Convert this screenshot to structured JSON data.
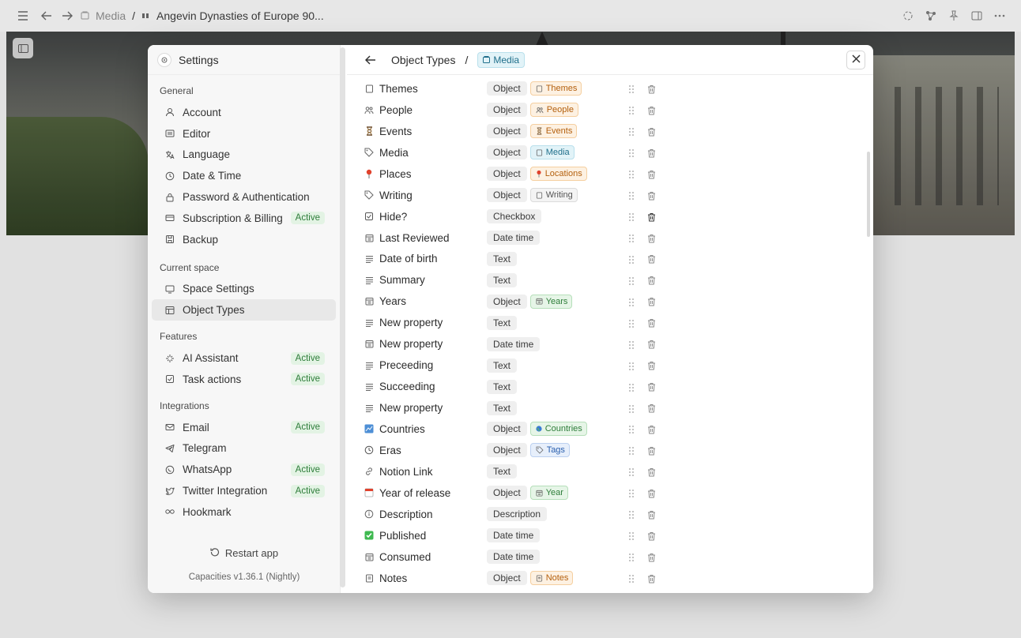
{
  "topbar": {
    "breadcrumb": [
      {
        "label": "Media",
        "icon": "media-icon"
      },
      {
        "label": "Angevin Dynasties of Europe 90..."
      }
    ],
    "separator": "/"
  },
  "sidebar": {
    "title": "Settings",
    "sections": [
      {
        "label": "General",
        "items": [
          {
            "label": "Account",
            "icon": "account-icon"
          },
          {
            "label": "Editor",
            "icon": "editor-icon"
          },
          {
            "label": "Language",
            "icon": "language-icon"
          },
          {
            "label": "Date & Time",
            "icon": "clock-icon"
          },
          {
            "label": "Password & Authentication",
            "icon": "lock-icon"
          },
          {
            "label": "Subscription & Billing",
            "icon": "card-icon",
            "badge": "Active"
          },
          {
            "label": "Backup",
            "icon": "backup-icon"
          }
        ]
      },
      {
        "label": "Current space",
        "items": [
          {
            "label": "Space Settings",
            "icon": "monitor-icon"
          },
          {
            "label": "Object Types",
            "icon": "table-icon",
            "selected": true
          }
        ]
      },
      {
        "label": "Features",
        "items": [
          {
            "label": "AI Assistant",
            "icon": "sparkle-icon",
            "badge": "Active"
          },
          {
            "label": "Task actions",
            "icon": "checkbox-icon",
            "badge": "Active"
          }
        ]
      },
      {
        "label": "Integrations",
        "items": [
          {
            "label": "Email",
            "icon": "mail-icon",
            "badge": "Active"
          },
          {
            "label": "Telegram",
            "icon": "telegram-icon"
          },
          {
            "label": "WhatsApp",
            "icon": "whatsapp-icon",
            "badge": "Active"
          },
          {
            "label": "Twitter Integration",
            "icon": "twitter-icon",
            "badge": "Active"
          },
          {
            "label": "Hookmark",
            "icon": "infinity-icon"
          }
        ]
      }
    ],
    "restart_label": "Restart app",
    "version": "Capacities v1.36.1 (Nightly)"
  },
  "main": {
    "title": "Object Types",
    "separator": "/",
    "chip": "Media",
    "properties": [
      {
        "name": "Themes",
        "type": "Object",
        "target": "Themes",
        "color": "orange",
        "icon": "page-icon"
      },
      {
        "name": "People",
        "type": "Object",
        "target": "People",
        "color": "orange",
        "icon": "people-icon"
      },
      {
        "name": "Events",
        "type": "Object",
        "target": "Events",
        "color": "orange",
        "icon": "hourglass-icon"
      },
      {
        "name": "Media",
        "type": "Object",
        "target": "Media",
        "color": "teal",
        "icon": "tag-icon"
      },
      {
        "name": "Places",
        "type": "Object",
        "target": "Locations",
        "color": "orange",
        "icon": "pin-icon"
      },
      {
        "name": "Writing",
        "type": "Object",
        "target": "Writing",
        "color": "gray",
        "icon": "tag-icon"
      },
      {
        "name": "Hide?",
        "type": "Checkbox",
        "icon": "checkbox-icon"
      },
      {
        "name": "Last Reviewed",
        "type": "Date time",
        "icon": "calendar-icon"
      },
      {
        "name": "Date of birth",
        "type": "Text",
        "icon": "text-icon"
      },
      {
        "name": "Summary",
        "type": "Text",
        "icon": "text-icon"
      },
      {
        "name": "Years",
        "type": "Object",
        "target": "Years",
        "color": "green",
        "icon": "calendar-icon"
      },
      {
        "name": "New property",
        "type": "Text",
        "icon": "text-icon"
      },
      {
        "name": "New property",
        "type": "Date time",
        "icon": "calendar-icon"
      },
      {
        "name": "Preceeding",
        "type": "Text",
        "icon": "text-icon"
      },
      {
        "name": "Succeeding",
        "type": "Text",
        "icon": "text-icon"
      },
      {
        "name": "New property",
        "type": "Text",
        "icon": "text-icon"
      },
      {
        "name": "Countries",
        "type": "Object",
        "target": "Countries",
        "color": "green",
        "icon": "map-icon"
      },
      {
        "name": "Eras",
        "type": "Object",
        "target": "Tags",
        "color": "blue",
        "icon": "clock-icon"
      },
      {
        "name": "Notion Link",
        "type": "Text",
        "icon": "link-icon"
      },
      {
        "name": "Year of release",
        "type": "Object",
        "target": "Year",
        "color": "green",
        "icon": "calendar-page-icon"
      },
      {
        "name": "Description",
        "type": "Description",
        "icon": "info-icon"
      },
      {
        "name": "Published",
        "type": "Date time",
        "icon": "check-green-icon"
      },
      {
        "name": "Consumed",
        "type": "Date time",
        "icon": "calendar-icon"
      },
      {
        "name": "Notes",
        "type": "Object",
        "target": "Notes",
        "color": "orange",
        "icon": "note-icon"
      }
    ]
  },
  "colors": {
    "active_badge": "#2e7d3a",
    "active_badge_bg": "#e3f3e4",
    "accent": "#1f6f8b"
  }
}
